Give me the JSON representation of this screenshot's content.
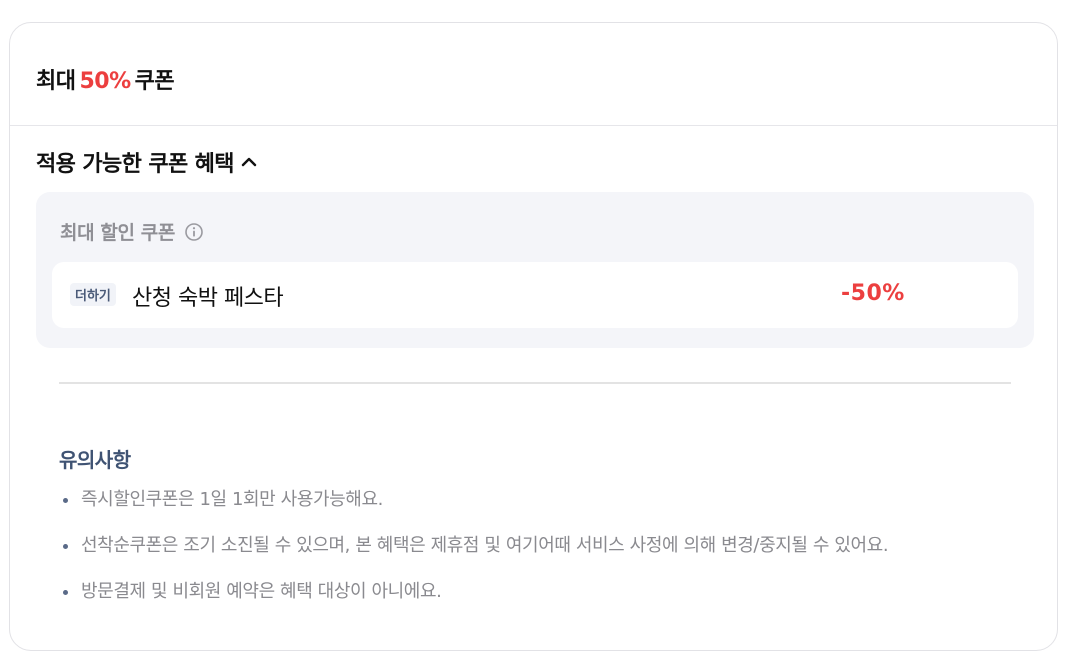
{
  "header": {
    "title_prefix": "최대",
    "title_percent": "50%",
    "title_suffix": "쿠폰"
  },
  "section": {
    "label": "적용 가능한 쿠폰 혜택",
    "expanded": true,
    "toggle_icon": "chevron-up-icon"
  },
  "coupon_box": {
    "title": "최대 할인 쿠폰",
    "info_icon": "info-icon",
    "coupons": [
      {
        "tag": "더하기",
        "name": "산청 숙박 페스타",
        "discount": "-50%"
      }
    ]
  },
  "notice": {
    "title": "유의사항",
    "items": [
      "즉시할인쿠폰은 1일 1회만 사용가능해요.",
      "선착순쿠폰은 조기 소진될 수 있으며, 본 혜택은 제휴점 및 여기어때 서비스 사정에 의해 변경/중지될 수 있어요.",
      "방문결제 및 비회원 예약은 혜택 대상이 아니에요."
    ]
  },
  "colors": {
    "accent_red": "#ec3f3f",
    "notice_title": "#3f5373",
    "box_background": "#f4f5f9"
  }
}
